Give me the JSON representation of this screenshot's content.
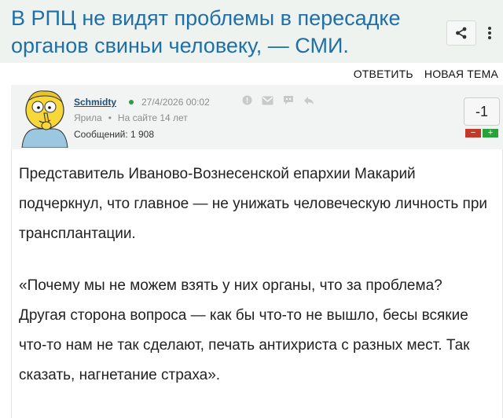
{
  "header": {
    "title": "В РПЦ не видят проблемы в пересадке органов свиньи человеку, — СМИ.",
    "share_icon": "share-icon",
    "more_icon": "more-vertical-icon"
  },
  "actions": {
    "reply_label": "ОТВЕТИТЬ",
    "new_topic_label": "НОВАЯ ТЕМА"
  },
  "post": {
    "author": "Schmidty",
    "datetime": "27/4/2026 00:02",
    "role": "Ярила",
    "on_site": "На сайте 14 лет",
    "messages": "Сообщений: 1 908",
    "rating": "-1",
    "vote_minus": "−",
    "vote_plus": "+",
    "icons": [
      "info-icon",
      "mail-icon",
      "quote-icon",
      "reply-icon"
    ],
    "paragraphs": [
      "Представитель Иваново-Вознесенской епархии Макарий подчеркнул, что главное — не унижать человеческую личность при трансплантации.",
      "«Почему мы не можем взять у них органы, что за проблема? Другая сторона вопроса — как бы что-то не вышло, бесы всякие что-то нам не так сделают, печать антихриста с разных мест. Так сказать, нагнетание страха»."
    ]
  },
  "colors": {
    "title": "#1f6fa8",
    "header_bg": "#eef3f0",
    "online": "#2a9d4a",
    "vote_minus": "#c0392b",
    "vote_plus": "#27a33a"
  }
}
